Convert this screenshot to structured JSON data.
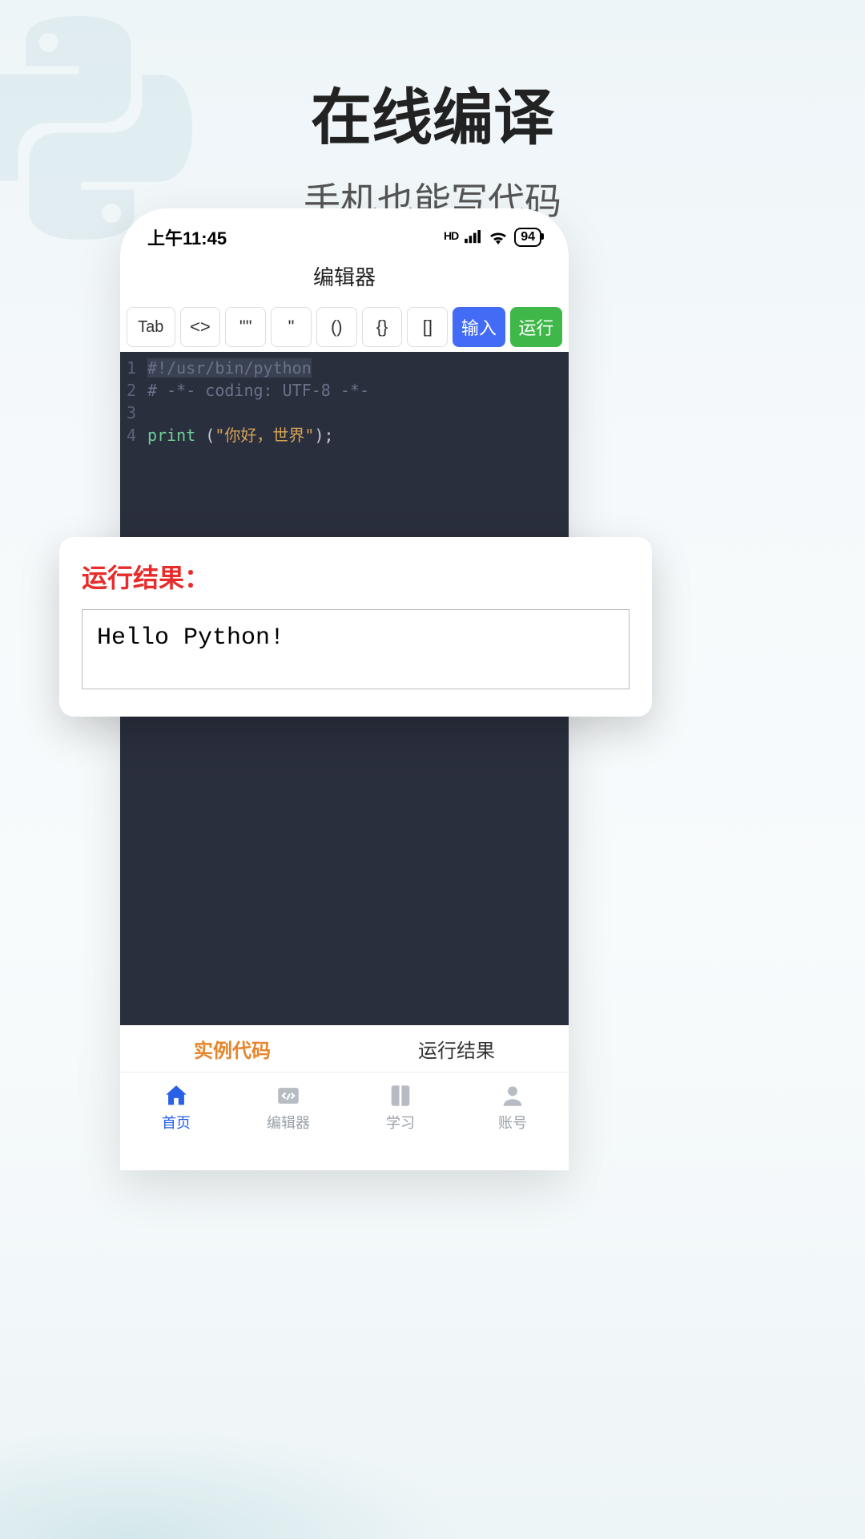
{
  "hero": {
    "title": "在线编译",
    "subtitle": "手机也能写代码"
  },
  "status_bar": {
    "time": "上午11:45",
    "battery": "94"
  },
  "app": {
    "title": "编辑器"
  },
  "toolbar": {
    "tab_key": "Tab",
    "angle": "<>",
    "dquote": "\"\"",
    "squote": "\"",
    "paren": "()",
    "brace": "{}",
    "bracket": "[]",
    "input_btn": "输入",
    "run_btn": "运行"
  },
  "editor": {
    "lines": [
      "1",
      "2",
      "3",
      "4"
    ],
    "l1": "#!/usr/bin/python",
    "l2": "# -*- coding: UTF-8 -*-",
    "l4_func": "print",
    "l4_open": " (",
    "l4_str": "\"你好，世界\"",
    "l4_close": ");"
  },
  "output": {
    "title": "运行结果：",
    "text": "Hello Python!"
  },
  "tabs": {
    "example": "实例代码",
    "result": "运行结果"
  },
  "nav": {
    "home": "首页",
    "editor": "编辑器",
    "learn": "学习",
    "account": "账号"
  }
}
